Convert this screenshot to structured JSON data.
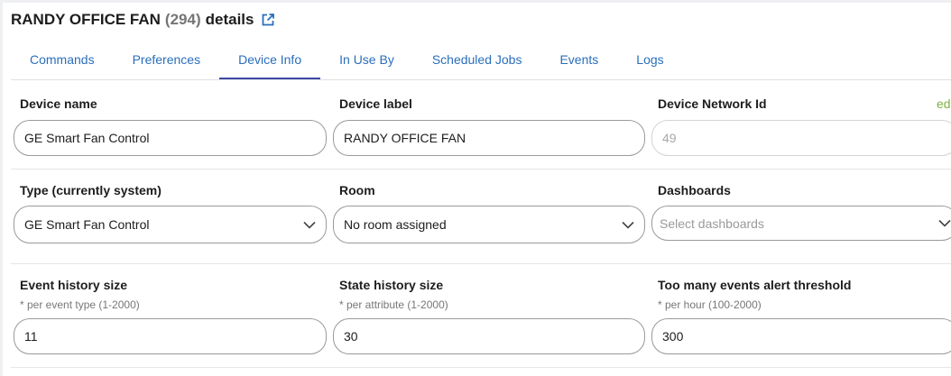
{
  "header": {
    "device_name": "RANDY OFFICE FAN",
    "device_count": "(294)",
    "suffix": "details",
    "external_link_icon": "external-link-icon",
    "accent_color": "#2a6ebb"
  },
  "tabs": [
    {
      "label": "Commands"
    },
    {
      "label": "Preferences"
    },
    {
      "label": "Device Info",
      "active": true
    },
    {
      "label": "In Use By"
    },
    {
      "label": "Scheduled Jobs"
    },
    {
      "label": "Events"
    },
    {
      "label": "Logs"
    }
  ],
  "device_info": {
    "device_name": {
      "label": "Device name",
      "value": "GE Smart Fan Control"
    },
    "device_label": {
      "label": "Device label",
      "value": "RANDY OFFICE FAN"
    },
    "device_network_id": {
      "label": "Device Network Id",
      "value": "49",
      "edit_link": "ed"
    },
    "type": {
      "label": "Type (currently system)",
      "value": "GE Smart Fan Control"
    },
    "room": {
      "label": "Room",
      "value": "No room assigned"
    },
    "dashboards": {
      "label": "Dashboards",
      "placeholder": "Select dashboards"
    },
    "event_history_size": {
      "label": "Event history size",
      "hint": "* per event type (1-2000)",
      "value": "11"
    },
    "state_history_size": {
      "label": "State history size",
      "hint": "* per attribute (1-2000)",
      "value": "30"
    },
    "alert_threshold": {
      "label": "Too many events alert threshold",
      "hint": "* per hour (100-2000)",
      "value": "300"
    }
  }
}
